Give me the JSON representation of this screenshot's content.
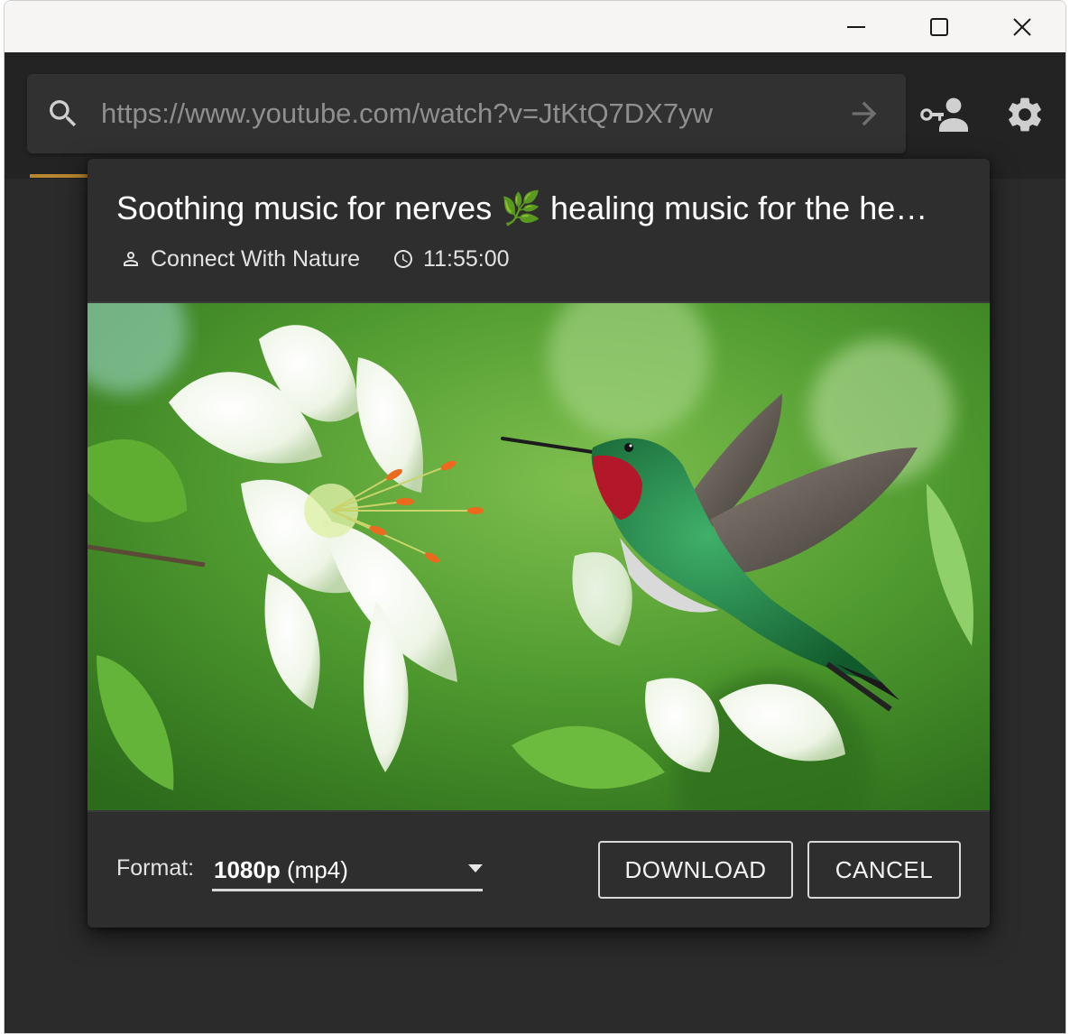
{
  "window": {
    "controls": {
      "minimize_icon": "minimize-icon",
      "maximize_icon": "maximize-icon",
      "close_icon": "close-icon"
    }
  },
  "toolbar": {
    "url_value": "https://www.youtube.com/watch?v=JtKtQ7DX7yw",
    "search_icon": "search-icon",
    "go_icon": "arrow-right-icon",
    "account_icon": "account-key-icon",
    "settings_icon": "gear-icon",
    "accent_color": "#b8862f"
  },
  "dialog": {
    "title": "Soothing music for nerves 🌿 healing music for the he…",
    "channel": "Connect With Nature",
    "duration": "11:55:00",
    "thumbnail_alt": "Hummingbird and white lily",
    "format_label": "Format:",
    "format_quality": "1080p",
    "format_container": "(mp4)",
    "download_label": "DOWNLOAD",
    "cancel_label": "CANCEL"
  }
}
